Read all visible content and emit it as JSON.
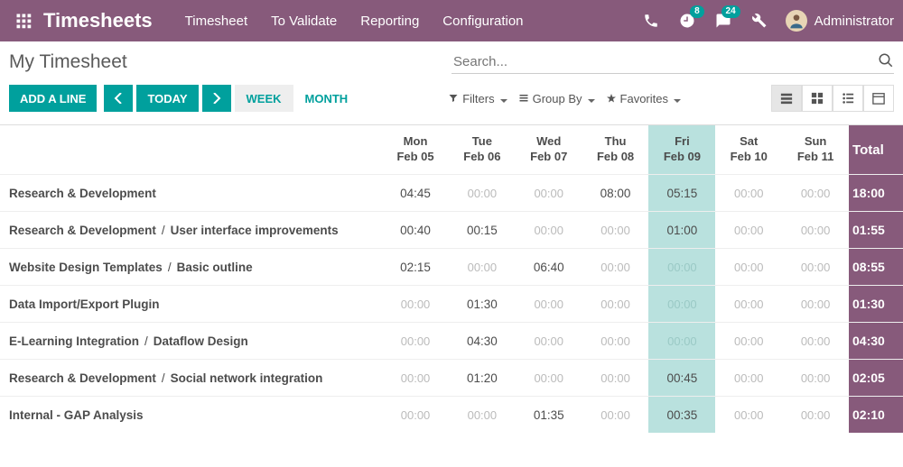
{
  "header": {
    "app_name": "Timesheets",
    "menu": [
      "Timesheet",
      "To Validate",
      "Reporting",
      "Configuration"
    ],
    "clock_badge": "8",
    "chat_badge": "24",
    "user_name": "Administrator"
  },
  "subhead": {
    "page_title": "My Timesheet",
    "search_placeholder": "Search..."
  },
  "toolbar": {
    "add_line": "ADD A LINE",
    "today": "TODAY",
    "week": "WEEK",
    "month": "MONTH",
    "filters": "Filters",
    "group_by": "Group By",
    "favorites": "Favorites"
  },
  "grid": {
    "days": [
      {
        "dow": "Mon",
        "date": "Feb 05"
      },
      {
        "dow": "Tue",
        "date": "Feb 06"
      },
      {
        "dow": "Wed",
        "date": "Feb 07"
      },
      {
        "dow": "Thu",
        "date": "Feb 08"
      },
      {
        "dow": "Fri",
        "date": "Feb 09"
      },
      {
        "dow": "Sat",
        "date": "Feb 10"
      },
      {
        "dow": "Sun",
        "date": "Feb 11"
      }
    ],
    "total_label": "Total",
    "highlight_index": 4,
    "rows": [
      {
        "label": "Research & Development",
        "cells": [
          "04:45",
          "00:00",
          "00:00",
          "08:00",
          "05:15",
          "00:00",
          "00:00"
        ],
        "total": "18:00"
      },
      {
        "label": "Research & Development / User interface improvements",
        "cells": [
          "00:40",
          "00:15",
          "00:00",
          "00:00",
          "01:00",
          "00:00",
          "00:00"
        ],
        "total": "01:55"
      },
      {
        "label": "Website Design Templates / Basic outline",
        "cells": [
          "02:15",
          "00:00",
          "06:40",
          "00:00",
          "00:00",
          "00:00",
          "00:00"
        ],
        "total": "08:55"
      },
      {
        "label": "Data Import/Export Plugin",
        "cells": [
          "00:00",
          "01:30",
          "00:00",
          "00:00",
          "00:00",
          "00:00",
          "00:00"
        ],
        "total": "01:30"
      },
      {
        "label": "E-Learning Integration / Dataflow Design",
        "cells": [
          "00:00",
          "04:30",
          "00:00",
          "00:00",
          "00:00",
          "00:00",
          "00:00"
        ],
        "total": "04:30"
      },
      {
        "label": "Research & Development / Social network integration",
        "cells": [
          "00:00",
          "01:20",
          "00:00",
          "00:00",
          "00:45",
          "00:00",
          "00:00"
        ],
        "total": "02:05"
      },
      {
        "label": "Internal - GAP Analysis",
        "cells": [
          "00:00",
          "00:00",
          "01:35",
          "00:00",
          "00:35",
          "00:00",
          "00:00"
        ],
        "total": "02:10"
      }
    ]
  }
}
